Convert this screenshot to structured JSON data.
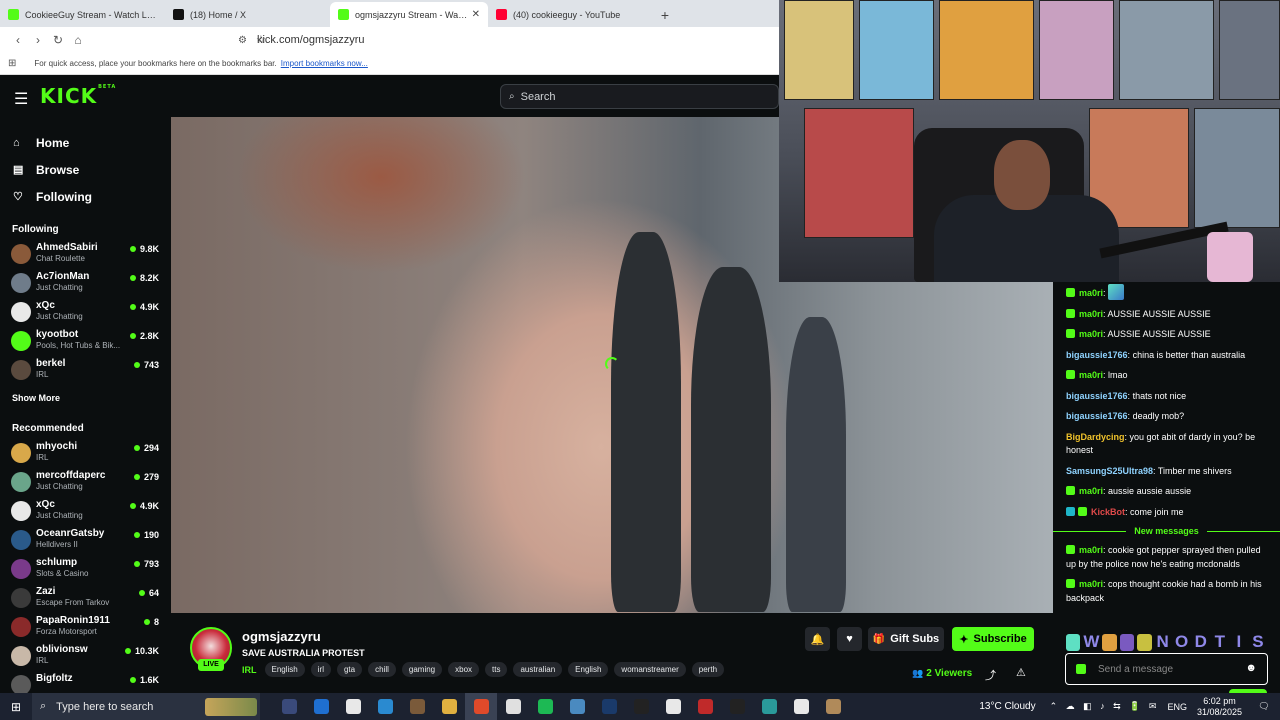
{
  "browser": {
    "tabs": [
      {
        "label": "CookieeGuy Stream - Watch Live",
        "color": "#53fc18"
      },
      {
        "label": "(18) Home / X",
        "color": "#111111"
      },
      {
        "label": "ogmsjazzyru Stream - Watch Live",
        "color": "#53fc18",
        "close": "✕"
      },
      {
        "label": "(40) cookieeguy - YouTube",
        "color": "#ff0033"
      }
    ],
    "new_tab": "+",
    "url": "kick.com/ogmsjazzyru",
    "bookmarks_text": "For quick access, place your bookmarks here on the bookmarks bar.",
    "import_link": "Import bookmarks now..."
  },
  "kick": {
    "logo": "KICK",
    "logo_badge": "BETA",
    "search_placeholder": "Search"
  },
  "sidebar": {
    "nav": [
      {
        "label": "Home",
        "icon": "⌂"
      },
      {
        "label": "Browse",
        "icon": "▤"
      },
      {
        "label": "Following",
        "icon": "♡"
      }
    ],
    "following_header": "Following",
    "following": [
      {
        "name": "AhmedSabiri",
        "category": "Chat Roulette",
        "viewers": "9.8K",
        "color": "#8a5a3a"
      },
      {
        "name": "Ac7ionMan",
        "category": "Just Chatting",
        "viewers": "8.2K",
        "color": "#6f7c8a"
      },
      {
        "name": "xQc",
        "category": "Just Chatting",
        "viewers": "4.9K",
        "color": "#e8e8e8"
      },
      {
        "name": "kyootbot",
        "category": "Pools, Hot Tubs & Bik...",
        "viewers": "2.8K",
        "color": "#53fc18"
      },
      {
        "name": "berkel",
        "category": "IRL",
        "viewers": "743",
        "color": "#5a4a3e"
      }
    ],
    "show_more": "Show More",
    "recommended_header": "Recommended",
    "recommended": [
      {
        "name": "mhyochi",
        "category": "IRL",
        "viewers": "294",
        "color": "#d8a84a"
      },
      {
        "name": "mercoffdaperc",
        "category": "Just Chatting",
        "viewers": "279",
        "color": "#6aa58a"
      },
      {
        "name": "xQc",
        "category": "Just Chatting",
        "viewers": "4.9K",
        "color": "#e8e8e8"
      },
      {
        "name": "OceanrGatsby",
        "category": "Helldivers II",
        "viewers": "190",
        "color": "#2a5a8a"
      },
      {
        "name": "schlump",
        "category": "Slots & Casino",
        "viewers": "793",
        "color": "#7a3a8a"
      },
      {
        "name": "Zazi",
        "category": "Escape From Tarkov",
        "viewers": "64",
        "color": "#3a3a3a"
      },
      {
        "name": "PapaRonin1911",
        "category": "Forza Motorsport",
        "viewers": "8",
        "color": "#8a2a2a"
      },
      {
        "name": "oblivionsw",
        "category": "IRL",
        "viewers": "10.3K",
        "color": "#c8b8a8"
      },
      {
        "name": "Bigfoltz",
        "category": "",
        "viewers": "1.6K",
        "color": "#5a5a5a"
      }
    ]
  },
  "stream": {
    "streamer": "ogmsjazzyru",
    "live_label": "LIVE",
    "title": "SAVE AUSTRALIA PROTEST",
    "category": "IRL",
    "tags": [
      "English",
      "irl",
      "gta",
      "chill",
      "gaming",
      "xbox",
      "tts",
      "australian",
      "English",
      "womanstreamer",
      "perth"
    ],
    "gift_label": "Gift Subs",
    "subscribe_label": "Subscribe",
    "viewer_count": "2",
    "viewer_word": "Viewers",
    "icons": {
      "bell": "🔔",
      "heart": "♥",
      "gift": "🎁",
      "star": "✦",
      "share": "⤴",
      "warn": "⚠",
      "viewers": "👥"
    }
  },
  "chat": {
    "messages_before": [
      {
        "user": "ma0ri",
        "text": "",
        "color": "green",
        "badge": true,
        "emote": true
      },
      {
        "user": "ma0ri",
        "text": "AUSSIE AUSSIE AUSSIE",
        "color": "green",
        "badge": true
      },
      {
        "user": "ma0ri",
        "text": "AUSSIE AUSSIE AUSSIE",
        "color": "green",
        "badge": true
      },
      {
        "user": "bigaussie1766",
        "text": "china is better than australia",
        "color": "blue",
        "badge": false
      },
      {
        "user": "ma0ri",
        "text": "lmao",
        "color": "green",
        "badge": true
      },
      {
        "user": "bigaussie1766",
        "text": "thats not nice",
        "color": "blue",
        "badge": false
      },
      {
        "user": "bigaussie1766",
        "text": "deadly mob?",
        "color": "blue",
        "badge": false
      },
      {
        "user": "BigDardycing",
        "text": "you got abit of dardy in you? be honest",
        "color": "yellow",
        "badge": false
      },
      {
        "user": "SamsungS25Ultra98",
        "text": "Timber me shivers",
        "color": "blue",
        "badge": false
      },
      {
        "user": "ma0ri",
        "text": "aussie aussie aussie",
        "color": "green",
        "badge": true
      },
      {
        "user": "KickBot",
        "text": "come join me",
        "color": "red",
        "badge": false,
        "botbadges": true
      }
    ],
    "new_messages_label": "New messages",
    "messages_after": [
      {
        "user": "ma0ri",
        "text": "cookie got pepper sprayed then pulled up by the police now he's eating mcdonalds",
        "color": "green",
        "badge": true
      },
      {
        "user": "ma0ri",
        "text": "cops thought cookie had a bomb in his backpack",
        "color": "green",
        "badge": true
      }
    ],
    "emote_letters": [
      "W",
      "N",
      "O",
      "D",
      "T",
      "I",
      "S"
    ],
    "input_placeholder": "Send a message",
    "smile_icon": "☻"
  },
  "taskbar": {
    "start_icon": "⊞",
    "search_placeholder": "Type here to search",
    "weather": "13°C  Cloudy",
    "tray_icons": "⌃ ☁ ◧ ♪ ⇆ 🔋 ✉",
    "language": "ENG",
    "time": "6:02 pm",
    "date": "31/08/2025",
    "notify_icon": "🗨",
    "apps": [
      "#3a4a7a",
      "#1f6fd0",
      "#e8e8e8",
      "#2a8ad0",
      "#7a5a3a",
      "#e0b040",
      "#e04a2a",
      "#e0e0e0",
      "#1db954",
      "#4a8ac0",
      "#1a3a6a",
      "#222222",
      "#e8e8e8",
      "#c02a2a",
      "#222222",
      "#2a9a9a",
      "#e8e8e8",
      "#b08a5a"
    ]
  }
}
